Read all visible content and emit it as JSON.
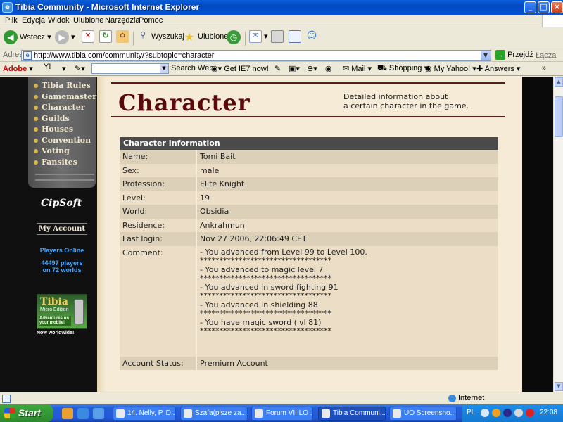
{
  "window": {
    "title": "Tibia Community - Microsoft Internet Explorer"
  },
  "menu": [
    "Plik",
    "Edycja",
    "Widok",
    "Ulubione",
    "Narzędzia",
    "Pomoc"
  ],
  "toolbar": {
    "back": "Wstecz",
    "search": "Wyszukaj",
    "favorites": "Ulubione"
  },
  "address": {
    "label": "Adres",
    "url": "http://www.tibia.com/community/?subtopic=character",
    "go": "Przejdź",
    "links": "Łącza"
  },
  "ytoolbar": {
    "adobe": "Adobe",
    "yahoo": "Y!",
    "search_web": "Search Web",
    "get_ie7": "Get IE7 now!",
    "mail": "Mail",
    "shopping": "Shopping",
    "my_yahoo": "My Yahoo!",
    "answers": "Answers"
  },
  "nav": {
    "items": [
      "Tibia Rules",
      "Gamemaster",
      "Character",
      "Guilds",
      "Houses",
      "Convention",
      "Voting",
      "Fansites"
    ],
    "cipsoft": "CipSoft",
    "my_account": "My Account",
    "players_online": "Players Online",
    "players_count": "44497 players",
    "worlds": "on 72 worlds",
    "tibia_me_logo": "Tibia",
    "tibia_me_sub": "Micro Edition",
    "tibia_me_ad": "Adventures on your mobile!",
    "now_worldwide": "Now worldwide!"
  },
  "page": {
    "title": "Character",
    "desc1": "Detailed information about",
    "desc2": "a certain character in the game."
  },
  "table": {
    "header": "Character Information",
    "rows": [
      {
        "label": "Name:",
        "value": "Tomi Bait"
      },
      {
        "label": "Sex:",
        "value": "male"
      },
      {
        "label": "Profession:",
        "value": "Elite Knight"
      },
      {
        "label": "Level:",
        "value": "19"
      },
      {
        "label": "World:",
        "value": "Obsidia"
      },
      {
        "label": "Residence:",
        "value": "Ankrahmun"
      },
      {
        "label": "Last login:",
        "value": "Nov 27 2006, 22:06:49 CET"
      }
    ],
    "comment_label": "Comment:",
    "comment_lines": [
      "- You advanced from Level 99 to Level 100.",
      "**********************************",
      "- You advanced to magic level 7",
      "**********************************",
      "- You advanced in sword fighting 91",
      "**********************************",
      "- You advanced in shielding 88",
      "**********************************",
      "- You have magic sword (lvl 81)",
      "**********************************"
    ],
    "account_label": "Account Status:",
    "account_value": "Premium Account"
  },
  "status": {
    "zone": "Internet"
  },
  "taskbar": {
    "start": "Start",
    "tasks": [
      "14. Nelly, P. D...",
      "Szafa(pisze za...",
      "Forum VII LO ...",
      "Tibia Communi...",
      "UO Screensho..."
    ],
    "lang": "PL",
    "clock": "22:08"
  }
}
